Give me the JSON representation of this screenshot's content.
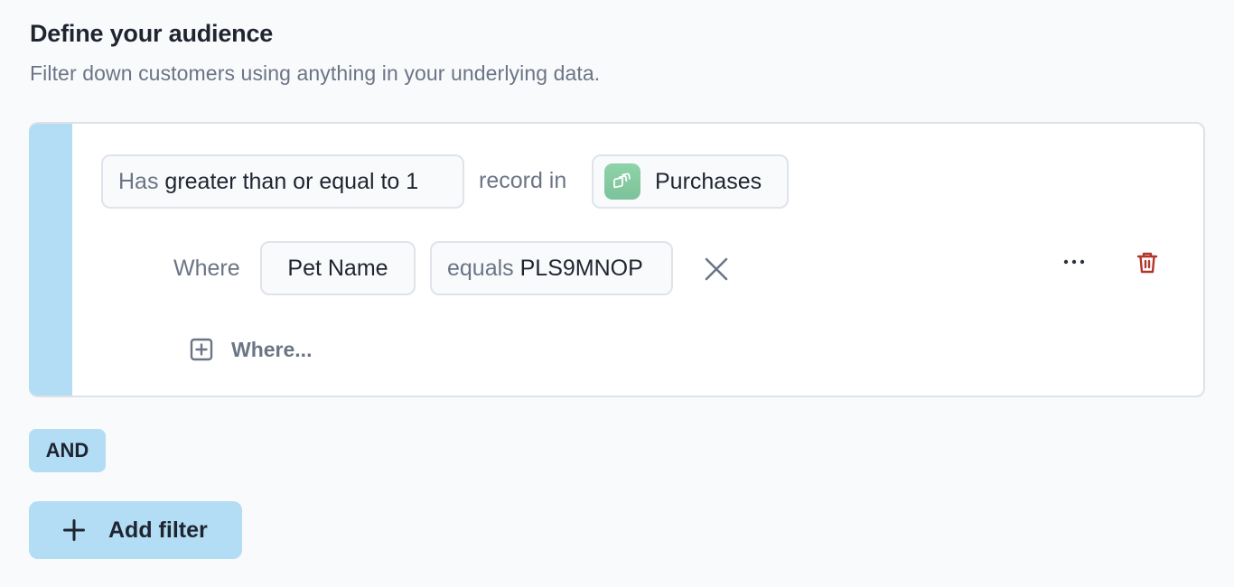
{
  "header": {
    "title": "Define your audience",
    "subtitle": "Filter down customers using anything in your underlying data."
  },
  "filter": {
    "count_prefix": "Has",
    "count_value": "greater than or equal to 1",
    "record_label": "record in",
    "table": {
      "name": "Purchases",
      "icon": "stacked-records-icon",
      "icon_color": "#86cba2"
    },
    "conditions": [
      {
        "where_label": "Where",
        "field": "Pet Name",
        "operator": "equals",
        "value": "PLS9MNOP"
      }
    ],
    "add_where_label": "Where...",
    "more_label": "...",
    "delete_color": "#b3362c"
  },
  "conjunction": "AND",
  "add_filter_label": "Add filter",
  "colors": {
    "accent": "#b2ddf4",
    "text": "#1f2530",
    "muted": "#6b7585",
    "border": "#dde1e8",
    "background": "#f9fafc"
  }
}
